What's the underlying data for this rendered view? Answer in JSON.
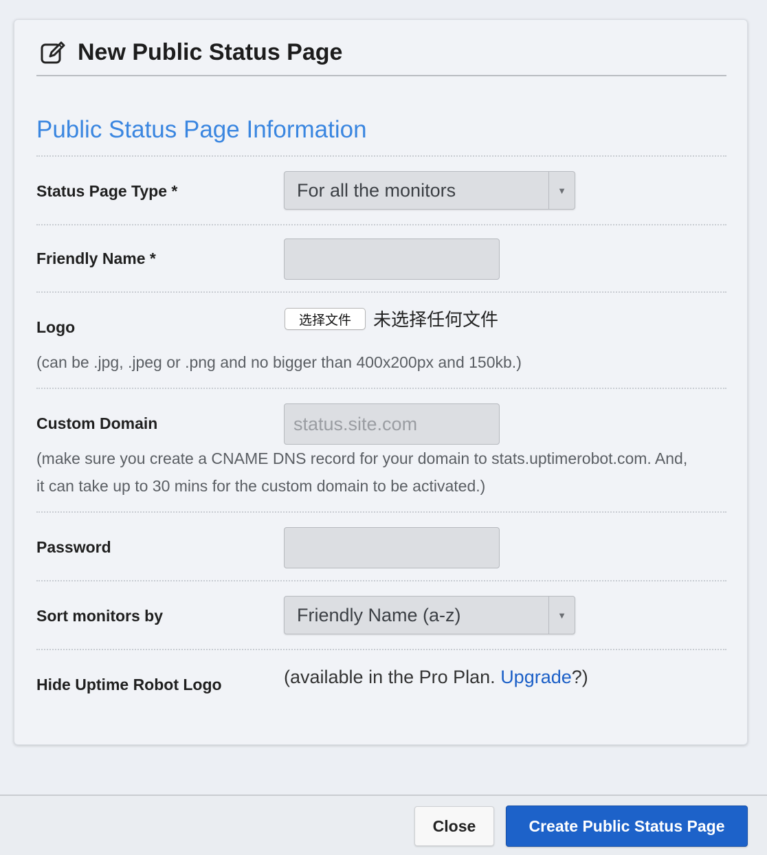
{
  "modal": {
    "title": "New Public Status Page",
    "title_icon": "edit-icon"
  },
  "section": {
    "title": "Public Status Page Information"
  },
  "fields": {
    "status_page_type": {
      "label": "Status Page Type *",
      "value": "For all the monitors"
    },
    "friendly_name": {
      "label": "Friendly Name *",
      "value": "",
      "placeholder": ""
    },
    "logo": {
      "label": "Logo",
      "button_label": "选择文件",
      "file_status": "未选择任何文件",
      "hint": "(can be .jpg, .jpeg or .png and no bigger than 400x200px and 150kb.)"
    },
    "custom_domain": {
      "label": "Custom Domain",
      "placeholder": "status.site.com",
      "hint_line1": "(make sure you create a CNAME DNS record for your domain to stats.uptimerobot.com. And,",
      "hint_line2": "it can take up to 30 mins for the custom domain to be activated.)"
    },
    "password": {
      "label": "Password",
      "value": ""
    },
    "sort_monitors": {
      "label": "Sort monitors by",
      "value": "Friendly Name (a-z)"
    },
    "hide_logo": {
      "label": "Hide Uptime Robot Logo",
      "note_prefix": "(available in the Pro Plan. ",
      "upgrade_link": "Upgrade",
      "note_suffix": "?)"
    }
  },
  "footer": {
    "close_label": "Close",
    "create_label": "Create Public Status Page"
  },
  "colors": {
    "section_title": "#3a86e0",
    "primary_button": "#1d62c9",
    "link": "#1b5fc7"
  }
}
